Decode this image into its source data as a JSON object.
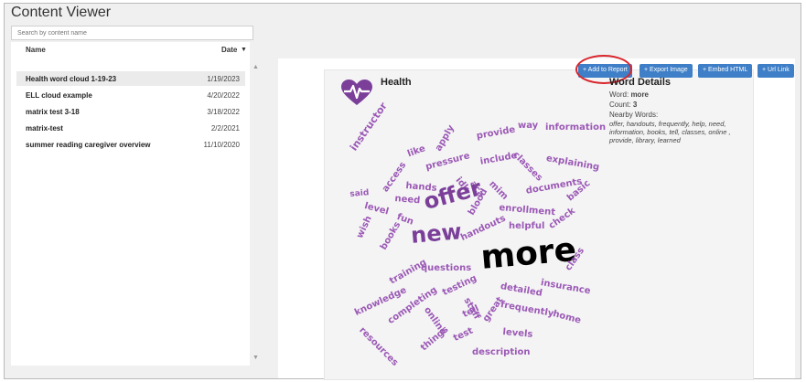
{
  "app": {
    "title": "Content Viewer"
  },
  "search": {
    "placeholder": "Search by content name"
  },
  "list": {
    "headers": {
      "name": "Name",
      "date": "Date"
    },
    "sort_icon": "caret-down-icon",
    "rows": [
      {
        "name": "Health word cloud 1-19-23",
        "date": "1/19/2023",
        "selected": true
      },
      {
        "name": "ELL cloud example",
        "date": "4/20/2022",
        "selected": false
      },
      {
        "name": "matrix test 3-18",
        "date": "3/18/2022",
        "selected": false
      },
      {
        "name": "matrix-test",
        "date": "2/2/2021",
        "selected": false
      },
      {
        "name": "summer reading caregiver overview",
        "date": "11/10/2020",
        "selected": false
      }
    ]
  },
  "toolbar": {
    "add_to_report": "+ Add to Report",
    "export_image": "+ Export Image",
    "embed_html": "+ Embed HTML",
    "url_link": "+ Url Link"
  },
  "cloud": {
    "title": "Health",
    "icon": "heart-pulse-icon",
    "accent": "#7b3f9a",
    "words": [
      {
        "text": "instructor",
        "color": "#9b59b6"
      },
      {
        "text": "apply",
        "color": "#9b59b6"
      },
      {
        "text": "provide",
        "color": "#9b59b6"
      },
      {
        "text": "way",
        "color": "#9b59b6"
      },
      {
        "text": "information",
        "color": "#9b59b6"
      },
      {
        "text": "like",
        "color": "#9b59b6"
      },
      {
        "text": "pressure",
        "color": "#9b59b6"
      },
      {
        "text": "include",
        "color": "#9b59b6"
      },
      {
        "text": "classes",
        "color": "#9b59b6"
      },
      {
        "text": "explaining",
        "color": "#9b59b6"
      },
      {
        "text": "access",
        "color": "#9b59b6"
      },
      {
        "text": "idk",
        "color": "#9b59b6"
      },
      {
        "text": "hands",
        "color": "#9b59b6"
      },
      {
        "text": "aca",
        "color": "#9b59b6"
      },
      {
        "text": "mim",
        "color": "#9b59b6"
      },
      {
        "text": "documents",
        "color": "#9b59b6"
      },
      {
        "text": "said",
        "color": "#9b59b6"
      },
      {
        "text": "need",
        "color": "#9b59b6"
      },
      {
        "text": "offer",
        "color": "#7b3f9a"
      },
      {
        "text": "basic",
        "color": "#9b59b6"
      },
      {
        "text": "level",
        "color": "#9b59b6"
      },
      {
        "text": "enrollment",
        "color": "#9b59b6"
      },
      {
        "text": "fun",
        "color": "#9b59b6"
      },
      {
        "text": "blood",
        "color": "#9b59b6"
      },
      {
        "text": "check",
        "color": "#9b59b6"
      },
      {
        "text": "books",
        "color": "#9b59b6"
      },
      {
        "text": "new",
        "color": "#7b3f9a"
      },
      {
        "text": "helpful",
        "color": "#9b59b6"
      },
      {
        "text": "wish",
        "color": "#9b59b6"
      },
      {
        "text": "handouts",
        "color": "#9b59b6"
      },
      {
        "text": "more",
        "color": "#000000"
      },
      {
        "text": "class",
        "color": "#9b59b6"
      },
      {
        "text": "training",
        "color": "#9b59b6"
      },
      {
        "text": "questions",
        "color": "#9b59b6"
      },
      {
        "text": "insurance",
        "color": "#9b59b6"
      },
      {
        "text": "knowledge",
        "color": "#9b59b6"
      },
      {
        "text": "completing",
        "color": "#9b59b6"
      },
      {
        "text": "testing",
        "color": "#9b59b6"
      },
      {
        "text": "detailed",
        "color": "#9b59b6"
      },
      {
        "text": "staff",
        "color": "#9b59b6"
      },
      {
        "text": "frequently",
        "color": "#9b59b6"
      },
      {
        "text": "home",
        "color": "#9b59b6"
      },
      {
        "text": "online",
        "color": "#9b59b6"
      },
      {
        "text": "tell",
        "color": "#9b59b6"
      },
      {
        "text": "great",
        "color": "#9b59b6"
      },
      {
        "text": "resources",
        "color": "#9b59b6"
      },
      {
        "text": "levels",
        "color": "#9b59b6"
      },
      {
        "text": "things",
        "color": "#9b59b6"
      },
      {
        "text": "test",
        "color": "#9b59b6"
      },
      {
        "text": "description",
        "color": "#9b59b6"
      }
    ]
  },
  "details": {
    "heading": "Word Details",
    "word_label": "Word:",
    "word": "more",
    "count_label": "Count:",
    "count": "3",
    "nearby_label": "Nearby Words:",
    "nearby": "offer, handouts, frequently, help, need, information, books, tell, classes, online , provide, library, learned"
  }
}
